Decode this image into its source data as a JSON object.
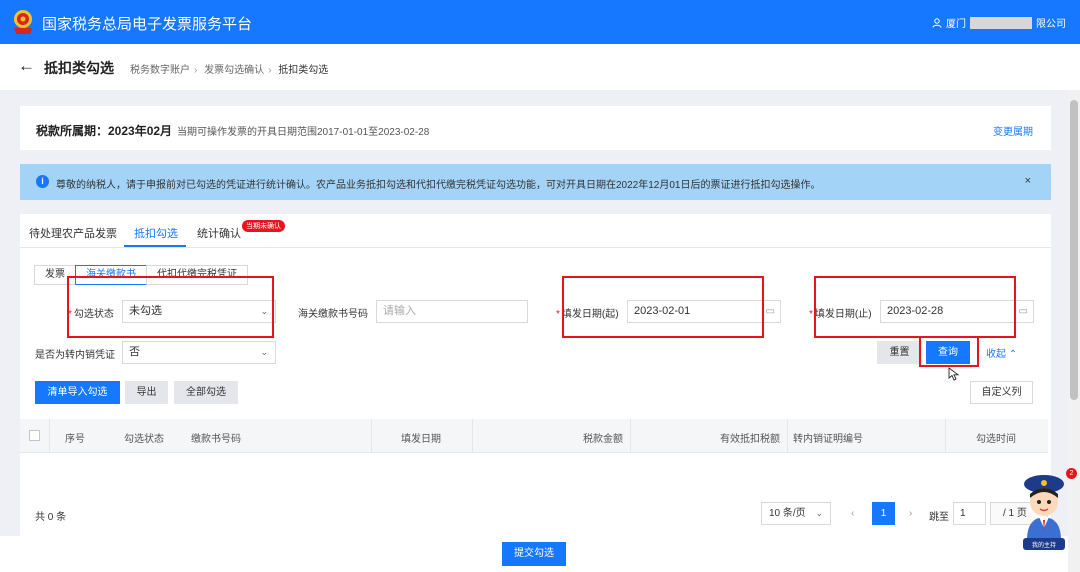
{
  "app": {
    "title": "国家税务总局电子发票服务平台",
    "user": {
      "prefix": "厦门",
      "suffix": "限公司"
    }
  },
  "header": {
    "back_icon": "arrow-left-icon",
    "page_title": "抵扣类勾选",
    "breadcrumbs": [
      "税务数字账户",
      "发票勾选确认",
      "抵扣类勾选"
    ]
  },
  "period": {
    "label": "税款所属期：2023年02月",
    "range_text": "当期可操作发票的开具日期范围2017-01-01至2023-02-28",
    "change_link": "变更属期"
  },
  "notice": {
    "icon": "info-icon",
    "text": "尊敬的纳税人，请于申报前对已勾选的凭证进行统计确认。农产品业务抵扣勾选和代扣代缴完税凭证勾选功能，可对开具日期在2022年12月01日后的票证进行抵扣勾选操作。",
    "close": "×"
  },
  "tabs": {
    "items": [
      "待处理农产品发票",
      "抵扣勾选",
      "统计确认"
    ],
    "active_index": 1,
    "badge": "当期未确认"
  },
  "subtabs": {
    "items": [
      "发票",
      "海关缴款书",
      "代扣代缴完税凭证"
    ],
    "active_index": 1
  },
  "filters": {
    "status_label": "勾选状态",
    "status_value": "未勾选",
    "customs_no_label": "海关缴款书号码",
    "customs_no_placeholder": "请输入",
    "date_from_label": "填发日期(起)",
    "date_from_value": "2023-02-01",
    "date_to_label": "填发日期(止)",
    "date_to_value": "2023-02-28",
    "transfer_label": "是否为转内销凭证",
    "transfer_value": "否",
    "reset": "重置",
    "query": "查询",
    "collapse": "收起"
  },
  "actions": {
    "import": "清单导入勾选",
    "export": "导出",
    "select_all": "全部勾选",
    "custom_columns": "自定义列"
  },
  "table": {
    "columns": [
      "序号",
      "勾选状态",
      "缴款书号码",
      "填发日期",
      "税款金额",
      "有效抵扣税额",
      "转内销证明编号",
      "勾选时间"
    ],
    "rows": []
  },
  "pagination": {
    "total": "共 0 条",
    "page_size": "10 条/页",
    "current_page": "1",
    "goto_label": "跳至",
    "goto_value": "1",
    "page_total": "/ 1 页"
  },
  "submit": "提交勾选",
  "mascot": {
    "badge": "2",
    "caption": "我的主持"
  },
  "colors": {
    "primary": "#1677ff",
    "highlight": "#e8141b",
    "notice_bg": "#a3d3f7"
  }
}
